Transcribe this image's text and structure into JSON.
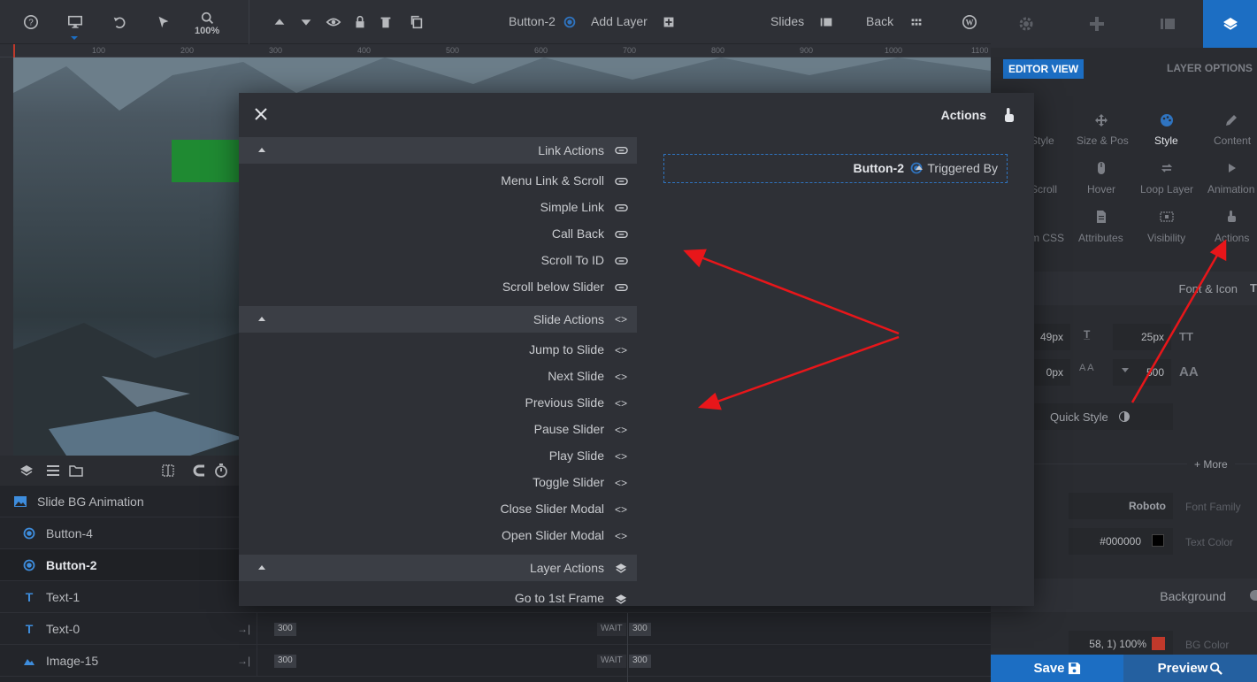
{
  "topbar": {
    "zoom": "100%",
    "current_layer": "Button-2",
    "add_layer": "Add Layer",
    "slides": "Slides",
    "back": "Back"
  },
  "ruler": {
    "ticks": [
      "100",
      "200",
      "300",
      "400",
      "500",
      "600",
      "700",
      "800",
      "900",
      "1000",
      "1100"
    ]
  },
  "right_panel": {
    "editor_view": "EDITOR VIEW",
    "layer_options": "LAYER OPTIONS",
    "icons_row1": [
      "Style",
      "Size & Pos",
      "Style",
      "Content"
    ],
    "icons_row2": [
      "Scroll",
      "Hover",
      "Loop Layer",
      "Animation"
    ],
    "icons_row3": [
      "m CSS",
      "Attributes",
      "Visibility",
      "Actions"
    ],
    "font_icon": "Font & Icon",
    "font_size": "49px",
    "line_height": "25px",
    "letter_spacing": "0px",
    "font_weight": "500",
    "quick_style": "Quick Style",
    "more": "+ More",
    "font_family_value": "Roboto",
    "font_family_label": "Font Family",
    "text_color_value": "#000000",
    "text_color_label": "Text Color",
    "background": "Background",
    "bg_color_value": "58, 1) 100%",
    "bg_color_label": "BG Color"
  },
  "colors": {
    "accent": "#1c6ec3",
    "text_swatch": "#000000",
    "bg_swatch": "#c0392b",
    "green_layer": "#1f8a32"
  },
  "layers": [
    {
      "name": "Slide BG Animation",
      "icon": "image-icon"
    },
    {
      "name": "Button-4",
      "icon": "button-icon"
    },
    {
      "name": "Button-2",
      "icon": "button-icon",
      "selected": true
    },
    {
      "name": "Text-1",
      "icon": "text-icon"
    },
    {
      "name": "Text-0",
      "icon": "text-icon",
      "start": "300",
      "wait": "WAIT",
      "wait_val": "300"
    },
    {
      "name": "Image-15",
      "icon": "image-icon",
      "start": "300",
      "wait": "WAIT",
      "wait_val": "300"
    }
  ],
  "modal": {
    "title": "Actions",
    "groups": [
      {
        "title": "Link Actions",
        "items": [
          "Menu Link & Scroll",
          "Simple Link",
          "Call Back",
          "Scroll To ID",
          "Scroll below Slider"
        ]
      },
      {
        "title": "Slide Actions",
        "items": [
          "Jump to Slide",
          "Next Slide",
          "Previous Slide",
          "Pause Slider",
          "Play Slide",
          "Toggle Slider",
          "Close Slider Modal",
          "Open Slider Modal"
        ]
      },
      {
        "title": "Layer Actions",
        "items": [
          "Go to 1st Frame"
        ]
      }
    ],
    "trigger_layer": "Button-2",
    "triggered_by": "Triggered By"
  },
  "footer": {
    "save": "Save",
    "preview": "Preview"
  }
}
